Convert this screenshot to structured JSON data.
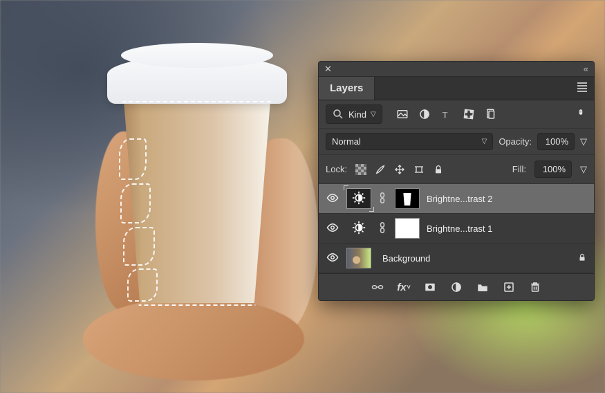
{
  "panel": {
    "title": "Layers",
    "filter": {
      "search_icon": "search",
      "kind_label": "Kind",
      "icons": [
        "image-filter",
        "adjustment-filter",
        "type-filter",
        "shape-filter",
        "smartobject-filter"
      ]
    },
    "blend": {
      "mode": "Normal",
      "opacity_label": "Opacity:",
      "opacity_value": "100%"
    },
    "lock": {
      "label": "Lock:",
      "fill_label": "Fill:",
      "fill_value": "100%"
    },
    "layers": [
      {
        "visible": true,
        "adjustment": "brightness-contrast",
        "mask": "cup",
        "name": "Brightne...trast 2",
        "selected": true
      },
      {
        "visible": true,
        "adjustment": "brightness-contrast",
        "mask": "white",
        "name": "Brightne...trast 1",
        "selected": false
      },
      {
        "visible": true,
        "adjustment": null,
        "mask": null,
        "name": "Background",
        "locked": true,
        "selected": false
      }
    ],
    "bottom_icons": [
      "link",
      "fx",
      "mask",
      "adjustment",
      "group",
      "new-layer",
      "trash"
    ]
  }
}
